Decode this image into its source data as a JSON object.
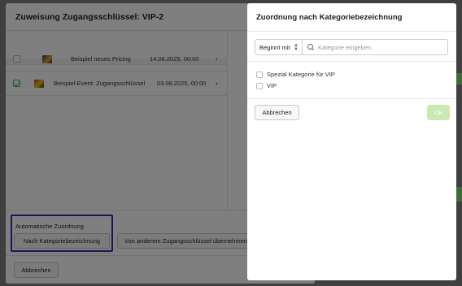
{
  "background_modal": {
    "title": "Zuweisung Zugangsschlüssel: VIP-2",
    "rows": [
      {
        "name": "Beispiel neues Pricing",
        "date": "14.06.2025, 00:00",
        "checked": false
      },
      {
        "name": "Beispiel-Event: Zugangsschlüssel",
        "date": "03.08.2025, 00:00",
        "checked": true
      }
    ],
    "assign_label": "Automatische Zuordnung",
    "by_category_button": "Nach Kategoriebezeichnung",
    "from_other_key_button": "Von anderem Zugangsschlüssel übernehmen",
    "cancel_button": "Abbrechen"
  },
  "panel": {
    "title": "Zuordnung nach Kategoriebezeichnung",
    "match_select": "Beginnt mit",
    "search_placeholder": "Kategorie eingeben",
    "options": [
      "Spezial Kategorie für VIP",
      "VIP"
    ],
    "cancel_button": "Abbrechen",
    "ok_button": "Ok"
  },
  "colors": {
    "highlight_border": "#3a2bb0",
    "ok_disabled": "#c9e8b5",
    "checked_green": "#4caf50"
  }
}
